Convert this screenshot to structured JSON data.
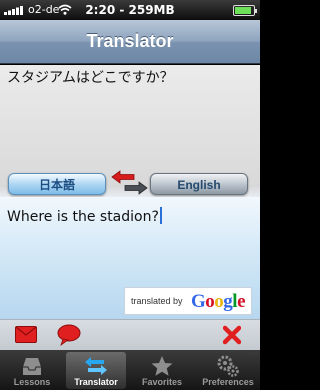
{
  "status_bar": {
    "carrier": "o2-de",
    "time": "2:20 - 259MB",
    "battery_level": 0.9
  },
  "nav": {
    "title": "Translator"
  },
  "source": {
    "text": "スタジアムはどこですか？",
    "language": "日本語"
  },
  "target": {
    "text": "Where is the stadion?",
    "language": "English"
  },
  "attribution": {
    "label": "translated by",
    "logo": "Google"
  },
  "actions": {
    "email_icon": "envelope-icon",
    "speech_icon": "speech-bubble-icon",
    "clear_icon": "close-icon"
  },
  "tabs": [
    {
      "label": "Lessons",
      "icon": "tray-icon",
      "active": false
    },
    {
      "label": "Translator",
      "icon": "swap-arrows-icon",
      "active": true
    },
    {
      "label": "Favorites",
      "icon": "star-icon",
      "active": false
    },
    {
      "label": "Preferences",
      "icon": "gears-icon",
      "active": false
    }
  ],
  "colors": {
    "nav_bar": "#8da3bd",
    "accent_red": "#d81c1c",
    "google_blue": "#3369e8",
    "google_red": "#d50f25",
    "google_yellow": "#eeb211",
    "google_green": "#009925"
  }
}
